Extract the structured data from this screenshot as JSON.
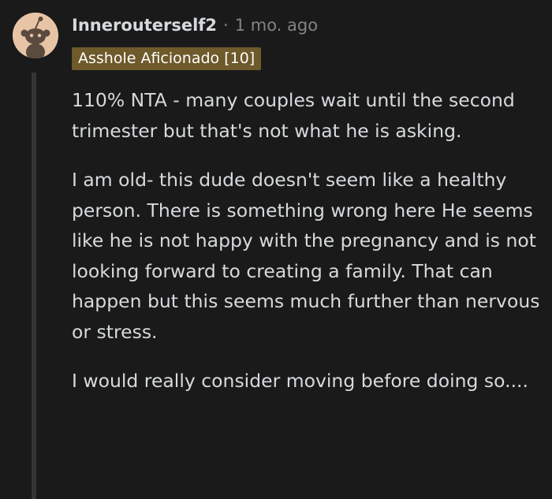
{
  "comment": {
    "author": "Innerouterself2",
    "separator": "·",
    "timestamp": "1 mo. ago",
    "flair": "Asshole Aficionado [10]",
    "avatar_icon": "reddit-snoo-avatar-icon",
    "paragraphs": [
      "110% NTA - many couples wait until the second trimester but that's not what he is asking.",
      "I am old- this dude doesn't seem like a healthy person. There is something wrong here He seems like he is not happy with the pregnancy and is not looking forward to creating a family. That can happen but this seems much further than nervous or stress.",
      "I would really consider moving before doing so...."
    ]
  },
  "colors": {
    "background": "#1a1a1b",
    "text": "#d7dadc",
    "muted": "#818384",
    "flair_bg": "#6e5a2a",
    "avatar_bg": "#e8c4a6",
    "thread_line": "#343536"
  }
}
